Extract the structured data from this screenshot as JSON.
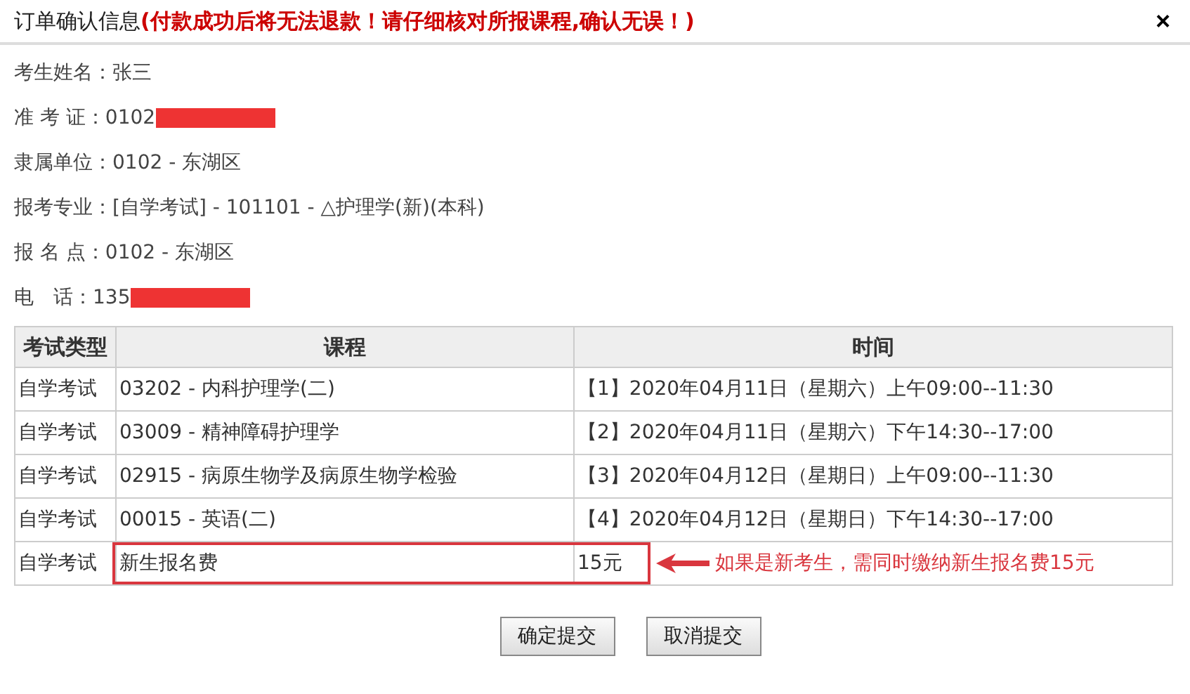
{
  "window": {
    "title": "订单确认信息",
    "warning": "(付款成功后将无法退款！请仔细核对所报课程,确认无误！)",
    "close": "×"
  },
  "fields": [
    {
      "label": "考生姓名：",
      "value": "张三",
      "redacted": false
    },
    {
      "label": "准 考 证：",
      "value": "0102",
      "redacted": true
    },
    {
      "label": "隶属单位：",
      "value": "0102 - 东湖区",
      "redacted": false
    },
    {
      "label": "报考专业：",
      "value": "[自学考试] - 101101 - △护理学(新)(本科)",
      "redacted": false
    },
    {
      "label": "报 名 点：",
      "value": "0102 - 东湖区",
      "redacted": false
    },
    {
      "label": "电　话：",
      "value": "135",
      "redacted": true
    }
  ],
  "table": {
    "columns": [
      "考试类型",
      "课程",
      "时间"
    ],
    "rows": [
      {
        "type": "自学考试",
        "course": "03202 - 内科护理学(二)",
        "time": "【1】2020年04月11日（星期六）上午09:00--11:30",
        "highlighted": false
      },
      {
        "type": "自学考试",
        "course": "03009 - 精神障碍护理学",
        "time": "【2】2020年04月11日（星期六）下午14:30--17:00",
        "highlighted": false
      },
      {
        "type": "自学考试",
        "course": "02915 - 病原生物学及病原生物学检验",
        "time": "【3】2020年04月12日（星期日）上午09:00--11:30",
        "highlighted": false
      },
      {
        "type": "自学考试",
        "course": "00015 - 英语(二)",
        "time": "【4】2020年04月12日（星期日）下午14:30--17:00",
        "highlighted": false
      },
      {
        "type": "自学考试",
        "course": "新生报名费",
        "time": "15元",
        "highlighted": true
      }
    ]
  },
  "annotation": "如果是新考生，需同时缴纳新生报名费15元",
  "buttons": [
    "确定提交",
    "取消提交"
  ]
}
